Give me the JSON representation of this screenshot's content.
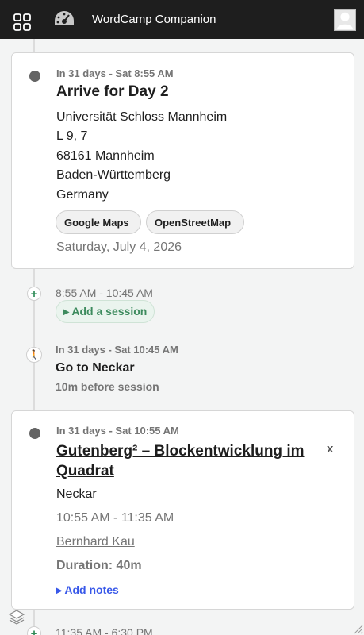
{
  "header": {
    "app_title": "WordCamp Companion",
    "menu_icon": "grid-icon",
    "logo_icon": "dashboard-gauge-icon",
    "avatar_icon": "user-avatar-icon"
  },
  "arrival": {
    "meta": "In 31 days - Sat 8:55 AM",
    "title": "Arrive for Day 2",
    "address": [
      "Universität Schloss Mannheim",
      "L 9, 7",
      "68161 Mannheim",
      "Baden-Württemberg",
      "Germany"
    ],
    "map_buttons": [
      "Google Maps",
      "OpenStreetMap"
    ],
    "date": "Saturday, July 4, 2026"
  },
  "gap1": {
    "time": "8:55 AM - 10:45 AM",
    "add_session_label": "▸ Add a session"
  },
  "travel": {
    "meta": "In 31 days - Sat 10:45 AM",
    "title": "Go to Neckar",
    "subtitle": "10m before session",
    "icon": "walking-person-icon"
  },
  "session": {
    "meta": "In 31 days - Sat 10:55 AM",
    "title": "Gutenberg² – Blockentwicklung im Quadrat",
    "close_label": "x",
    "room": "Neckar",
    "time": "10:55 AM - 11:35 AM",
    "speaker": "Bernhard Kau",
    "duration": "Duration: 40m",
    "add_notes_label": "▸ Add notes"
  },
  "gap2": {
    "time": "11:35 AM - 6:30 PM"
  },
  "colors": {
    "topbar": "#1e1e1e",
    "accent_green": "#3d8b5e",
    "link_blue": "#3858e9",
    "muted_text": "#757575"
  }
}
